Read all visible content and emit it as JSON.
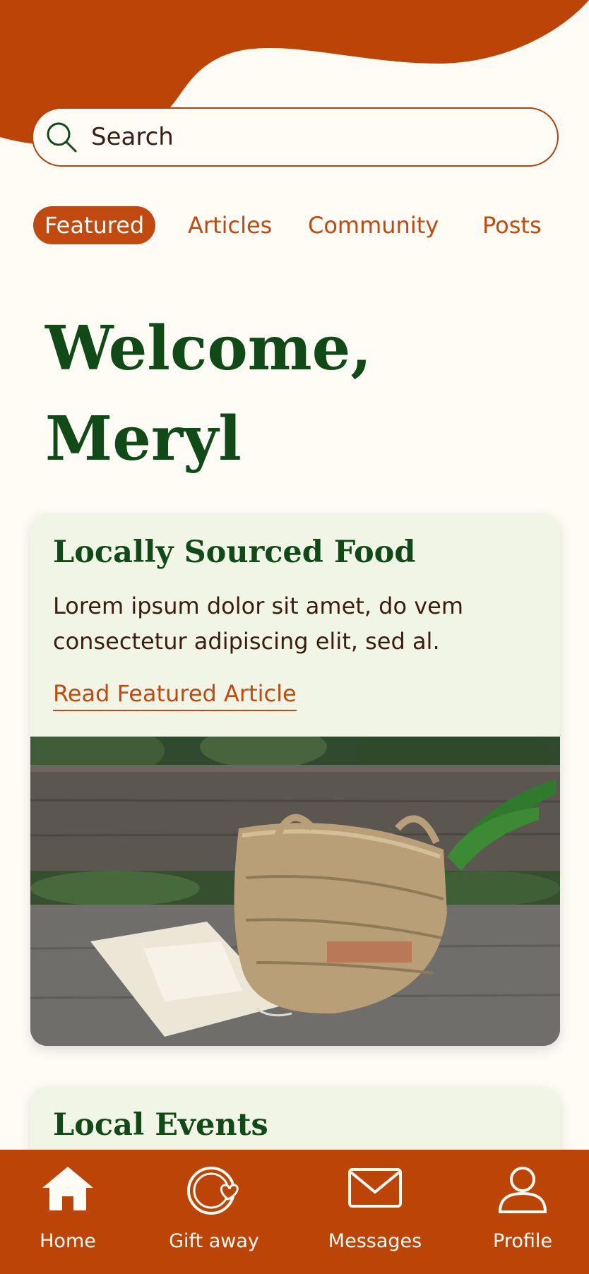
{
  "colors": {
    "accent": "#bd4407",
    "primary_green": "#0f4a17",
    "background": "#fffcf5",
    "card_background": "#f1f5e6",
    "text_dark": "#3a1d10"
  },
  "search": {
    "placeholder": "Search",
    "icon": "search-icon"
  },
  "tabs": [
    {
      "label": "Featured",
      "active": true
    },
    {
      "label": "Articles",
      "active": false
    },
    {
      "label": "Community",
      "active": false
    },
    {
      "label": "Posts",
      "active": false
    }
  ],
  "welcome": {
    "line1": "Welcome,",
    "line2": "Meryl"
  },
  "featured_card": {
    "title": "Locally Sourced Food",
    "description": "Lorem ipsum dolor sit amet, do vem consectetur adipiscing elit, sed al.",
    "link_label": "Read Featured Article"
  },
  "events_card": {
    "title": "Local Events"
  },
  "bottom_nav": [
    {
      "label": "Home",
      "icon": "home-icon"
    },
    {
      "label": "Gift away",
      "icon": "gift-away-icon"
    },
    {
      "label": "Messages",
      "icon": "envelope-icon"
    },
    {
      "label": "Profile",
      "icon": "profile-icon"
    }
  ]
}
